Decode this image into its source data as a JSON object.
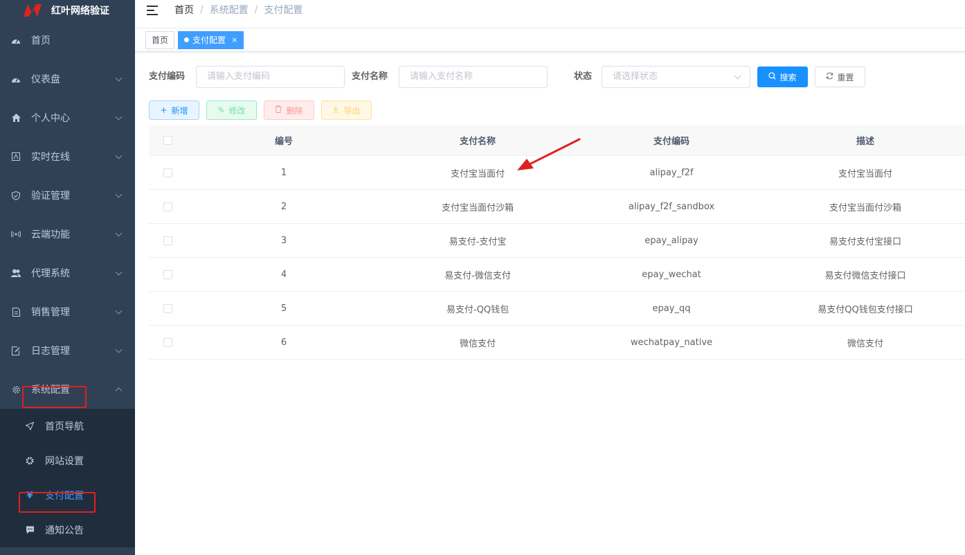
{
  "app": {
    "title": "红叶网络验证"
  },
  "sidebar": {
    "items": [
      {
        "label": "首页",
        "icon": "dashboard-icon"
      },
      {
        "label": "仪表盘",
        "icon": "gauge-icon"
      },
      {
        "label": "个人中心",
        "icon": "home-icon"
      },
      {
        "label": "实时在线",
        "icon": "online-icon"
      },
      {
        "label": "验证管理",
        "icon": "shield-icon"
      },
      {
        "label": "云端功能",
        "icon": "cloud-icon"
      },
      {
        "label": "代理系统",
        "icon": "user-group-icon"
      },
      {
        "label": "销售管理",
        "icon": "document-icon"
      },
      {
        "label": "日志管理",
        "icon": "edit-icon"
      },
      {
        "label": "系统配置",
        "icon": "gear-icon"
      }
    ],
    "sub_items": [
      {
        "label": "首页导航",
        "icon": "send-icon"
      },
      {
        "label": "网站设置",
        "icon": "cog-icon"
      },
      {
        "label": "支付配置",
        "icon": "yen-icon"
      },
      {
        "label": "通知公告",
        "icon": "message-icon"
      }
    ]
  },
  "breadcrumb": [
    "首页",
    "系统配置",
    "支付配置"
  ],
  "tags": {
    "home": "首页",
    "current": "支付配置",
    "close": "×"
  },
  "search": {
    "code_label": "支付编码",
    "code_placeholder": "请输入支付编码",
    "name_label": "支付名称",
    "name_placeholder": "请输入支付名称",
    "status_label": "状态",
    "status_placeholder": "请选择状态",
    "search_button": "搜索",
    "reset_button": "重置"
  },
  "toolbar": {
    "add": "新增",
    "edit": "修改",
    "delete": "删除",
    "export": "导出"
  },
  "table": {
    "headers": {
      "id": "编号",
      "name": "支付名称",
      "code": "支付编码",
      "desc": "描述"
    },
    "rows": [
      {
        "id": "1",
        "name": "支付宝当面付",
        "code": "alipay_f2f",
        "desc": "支付宝当面付"
      },
      {
        "id": "2",
        "name": "支付宝当面付沙箱",
        "code": "alipay_f2f_sandbox",
        "desc": "支付宝当面付沙箱"
      },
      {
        "id": "3",
        "name": "易支付-支付宝",
        "code": "epay_alipay",
        "desc": "易支付支付宝接口"
      },
      {
        "id": "4",
        "name": "易支付-微信支付",
        "code": "epay_wechat",
        "desc": "易支付微信支付接口"
      },
      {
        "id": "5",
        "name": "易支付-QQ钱包",
        "code": "epay_qq",
        "desc": "易支付QQ钱包支付接口"
      },
      {
        "id": "6",
        "name": "微信支付",
        "code": "wechatpay_native",
        "desc": "微信支付"
      }
    ]
  }
}
